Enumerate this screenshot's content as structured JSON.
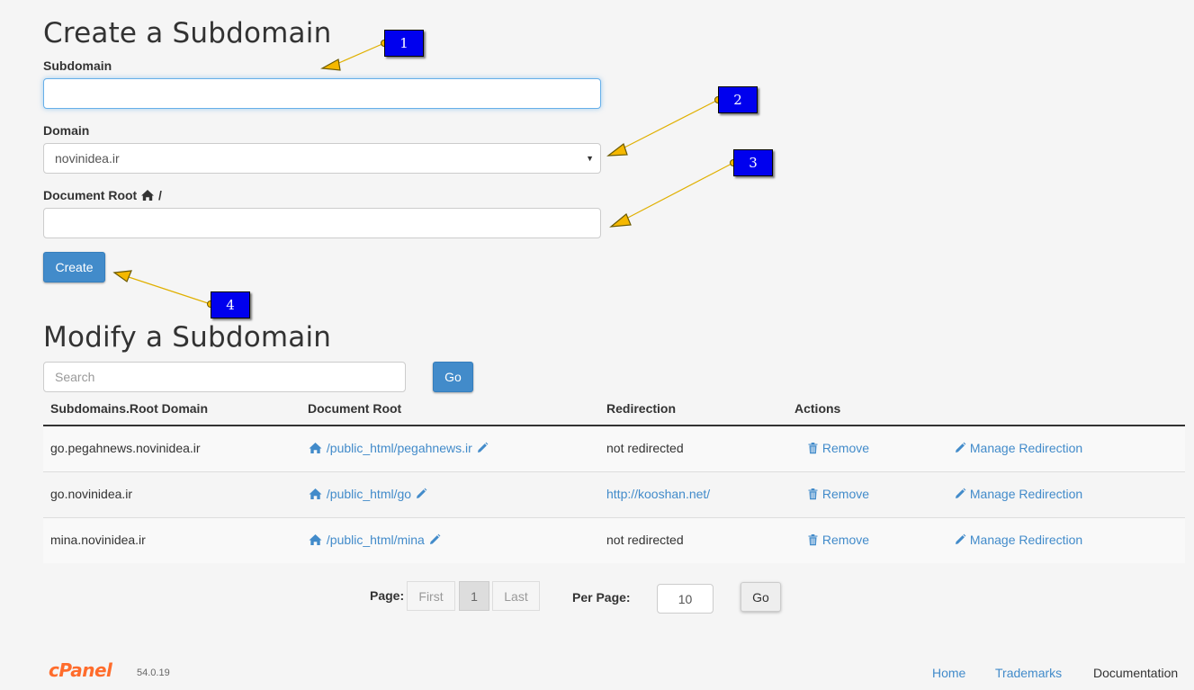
{
  "create": {
    "title": "Create a Subdomain",
    "subdomain_label": "Subdomain",
    "subdomain_value": "",
    "domain_label": "Domain",
    "domain_selected": "novinidea.ir",
    "docroot_label": "Document Root",
    "docroot_prefix": "/",
    "docroot_value": "",
    "create_button": "Create"
  },
  "callouts": [
    "1",
    "2",
    "3",
    "4"
  ],
  "modify": {
    "title": "Modify a Subdomain",
    "search_placeholder": "Search",
    "go_button": "Go",
    "columns": [
      "Subdomains.Root Domain",
      "Document Root",
      "Redirection",
      "Actions"
    ],
    "rows": [
      {
        "subdomain": "go.pegahnews.novinidea.ir",
        "docroot": "/public_html/pegahnews.ir",
        "redirection": "not redirected",
        "redirect_is_link": false,
        "remove": "Remove",
        "manage": "Manage Redirection"
      },
      {
        "subdomain": "go.novinidea.ir",
        "docroot": "/public_html/go",
        "redirection": "http://kooshan.net/",
        "redirect_is_link": true,
        "remove": "Remove",
        "manage": "Manage Redirection"
      },
      {
        "subdomain": "mina.novinidea.ir",
        "docroot": "/public_html/mina",
        "redirection": "not redirected",
        "redirect_is_link": false,
        "remove": "Remove",
        "manage": "Manage Redirection"
      }
    ]
  },
  "pagination": {
    "page_label": "Page:",
    "first": "First",
    "current": "1",
    "last": "Last",
    "per_page_label": "Per Page:",
    "per_page_value": "10",
    "go": "Go"
  },
  "footer": {
    "brand": "cPanel",
    "version": "54.0.19",
    "links": [
      "Home",
      "Trademarks",
      "Documentation"
    ]
  },
  "colors": {
    "accent": "#428bca",
    "brand": "#ff6c2c",
    "callout": "#0000ee",
    "arrow": "#f5b800"
  }
}
